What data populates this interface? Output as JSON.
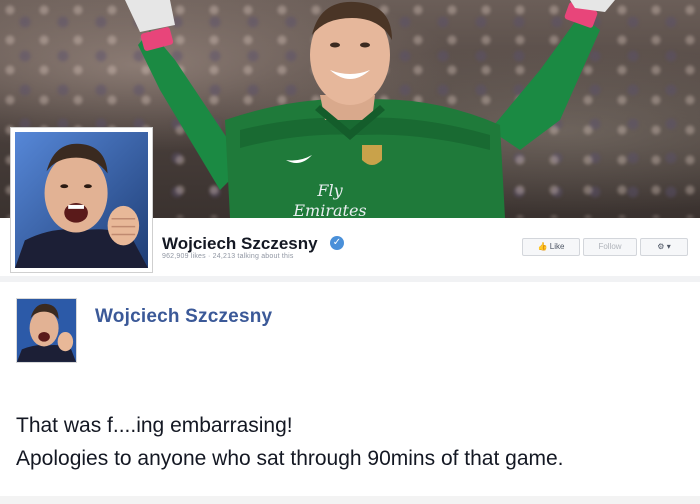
{
  "header": {
    "page_name": "Wojciech Szczesny",
    "stats": "962,909 likes · 24,213 talking about this",
    "buttons": {
      "like": "Like",
      "follow": "Follow",
      "more": "More"
    }
  },
  "cover": {
    "shirt_text_line1": "Fly",
    "shirt_text_line2": "Emirates"
  },
  "post": {
    "author": "Wojciech Szczesny",
    "line1": "That was f....ing embarrasing!",
    "line2": "Apologies to anyone who sat through 90mins of that game."
  },
  "colors": {
    "author_link": "#3b5998",
    "jersey_green": "#1f7a3a",
    "verified_badge": "#4a90d9"
  },
  "icons": [
    "verified-icon",
    "like-icon",
    "gear-icon",
    "chevron-down-icon"
  ]
}
